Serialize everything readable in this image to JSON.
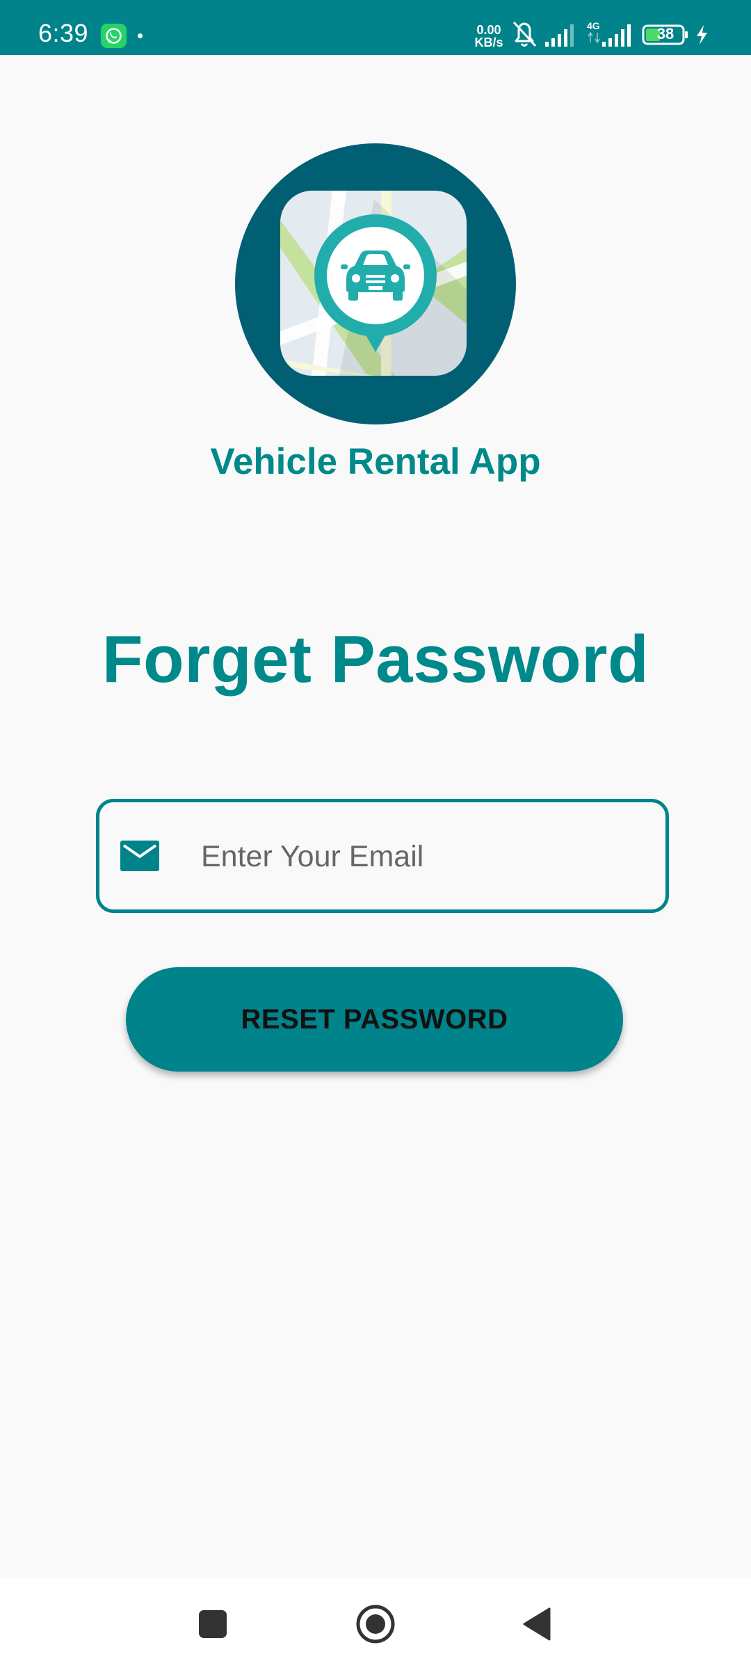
{
  "status_bar": {
    "time": "6:39",
    "net_speed_value": "0.00",
    "net_speed_unit": "KB/s",
    "network_type": "4G",
    "battery_level": "38",
    "icons": [
      "whatsapp-icon",
      "notification-dot-icon",
      "bell-muted-icon",
      "signal-icon",
      "signal-4g-icon",
      "battery-icon",
      "charging-icon"
    ]
  },
  "app": {
    "name": "Vehicle Rental App",
    "logo_icon": "car-location-pin-map-icon"
  },
  "page": {
    "title": "Forget Password"
  },
  "form": {
    "email": {
      "placeholder": "Enter Your Email",
      "value": "",
      "icon": "email-icon"
    },
    "reset_button_label": "RESET PASSWORD"
  },
  "nav_bar": {
    "buttons": [
      "recents-square-icon",
      "home-circle-icon",
      "back-triangle-icon"
    ]
  },
  "colors": {
    "primary": "#00838a",
    "title": "#00898a",
    "logo_circle": "#005f73",
    "background": "#f9f9f9"
  }
}
